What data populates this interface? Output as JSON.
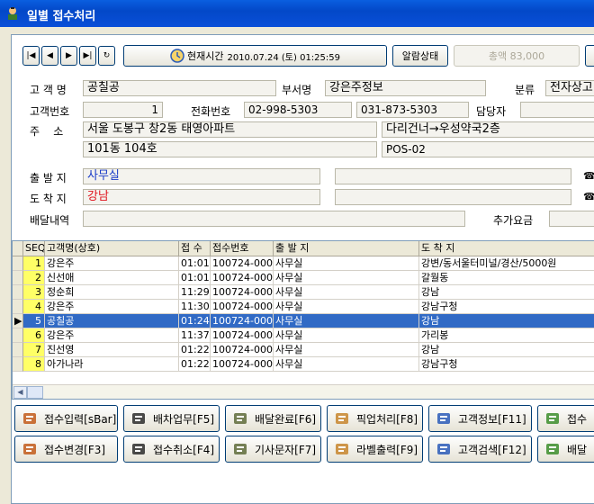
{
  "window": {
    "title": "일별 접수처리"
  },
  "toolbar": {
    "current_time_label": "현재시간",
    "current_time_value": "2010.07.24 (토) 01:25:59",
    "alarm_label": "알람상태",
    "total_label": "총액 83,000"
  },
  "form": {
    "customer_name_label": "고 객 명",
    "customer_name": "공칠공",
    "dept_label": "부서명",
    "dept": "강은주정보",
    "category_label": "분류",
    "category": "전자상고",
    "customer_no_label": "고객번호",
    "customer_no": "1",
    "phone_label": "전화번호",
    "phone1": "02-998-5303",
    "phone2": "031-873-5303",
    "manager_label": "담당자",
    "address_label": "주    소",
    "address1": "서울 도봉구 창2동 태영아파트",
    "address_note": "다리건너→우성약국2층",
    "address2": "101동 104호",
    "pos": "POS-02",
    "origin_label": "출 발 지",
    "origin": "사무실",
    "dest_label": "도 착 지",
    "dest": "강남",
    "delivery_label": "배달내역",
    "extra_fee_label": "추가요금"
  },
  "grid": {
    "headers": [
      "SEQ",
      "고객명(상호)",
      "접 수",
      "접수번호",
      "출 발 지",
      "도 착 지"
    ],
    "rows": [
      {
        "seq": "1",
        "name": "강은주",
        "time": "01:01",
        "no": "100724-0001",
        "origin": "사무실",
        "dest": "강변/동서울터미널/경산/5000원"
      },
      {
        "seq": "2",
        "name": "신선애",
        "time": "01:01",
        "no": "100724-0002",
        "origin": "사무실",
        "dest": "갈월동"
      },
      {
        "seq": "3",
        "name": "정순희",
        "time": "11:29",
        "no": "100724-0003",
        "origin": "사무실",
        "dest": "강남"
      },
      {
        "seq": "4",
        "name": "강은주",
        "time": "11:30",
        "no": "100724-0004",
        "origin": "사무실",
        "dest": "강남구청"
      },
      {
        "seq": "5",
        "name": "공칠공",
        "time": "01:24",
        "no": "100724-0005",
        "origin": "사무실",
        "dest": "강남"
      },
      {
        "seq": "6",
        "name": "강은주",
        "time": "11:37",
        "no": "100724-0006",
        "origin": "사무실",
        "dest": "가리봉"
      },
      {
        "seq": "7",
        "name": "진선영",
        "time": "01:22",
        "no": "100724-0007",
        "origin": "사무실",
        "dest": "강남"
      },
      {
        "seq": "8",
        "name": "아가나라",
        "time": "01:22",
        "no": "100724-0008",
        "origin": "사무실",
        "dest": "강남구청"
      }
    ]
  },
  "actions": {
    "row1": [
      "접수입력[sBar]",
      "배차업무[F5]",
      "배달완료[F6]",
      "픽업처리[F8]",
      "고객정보[F11]",
      "접수"
    ],
    "row2": [
      "접수변경[F3]",
      "접수취소[F4]",
      "기사문자[F7]",
      "라벨출력[F9]",
      "고객검색[F12]",
      "배달"
    ]
  }
}
